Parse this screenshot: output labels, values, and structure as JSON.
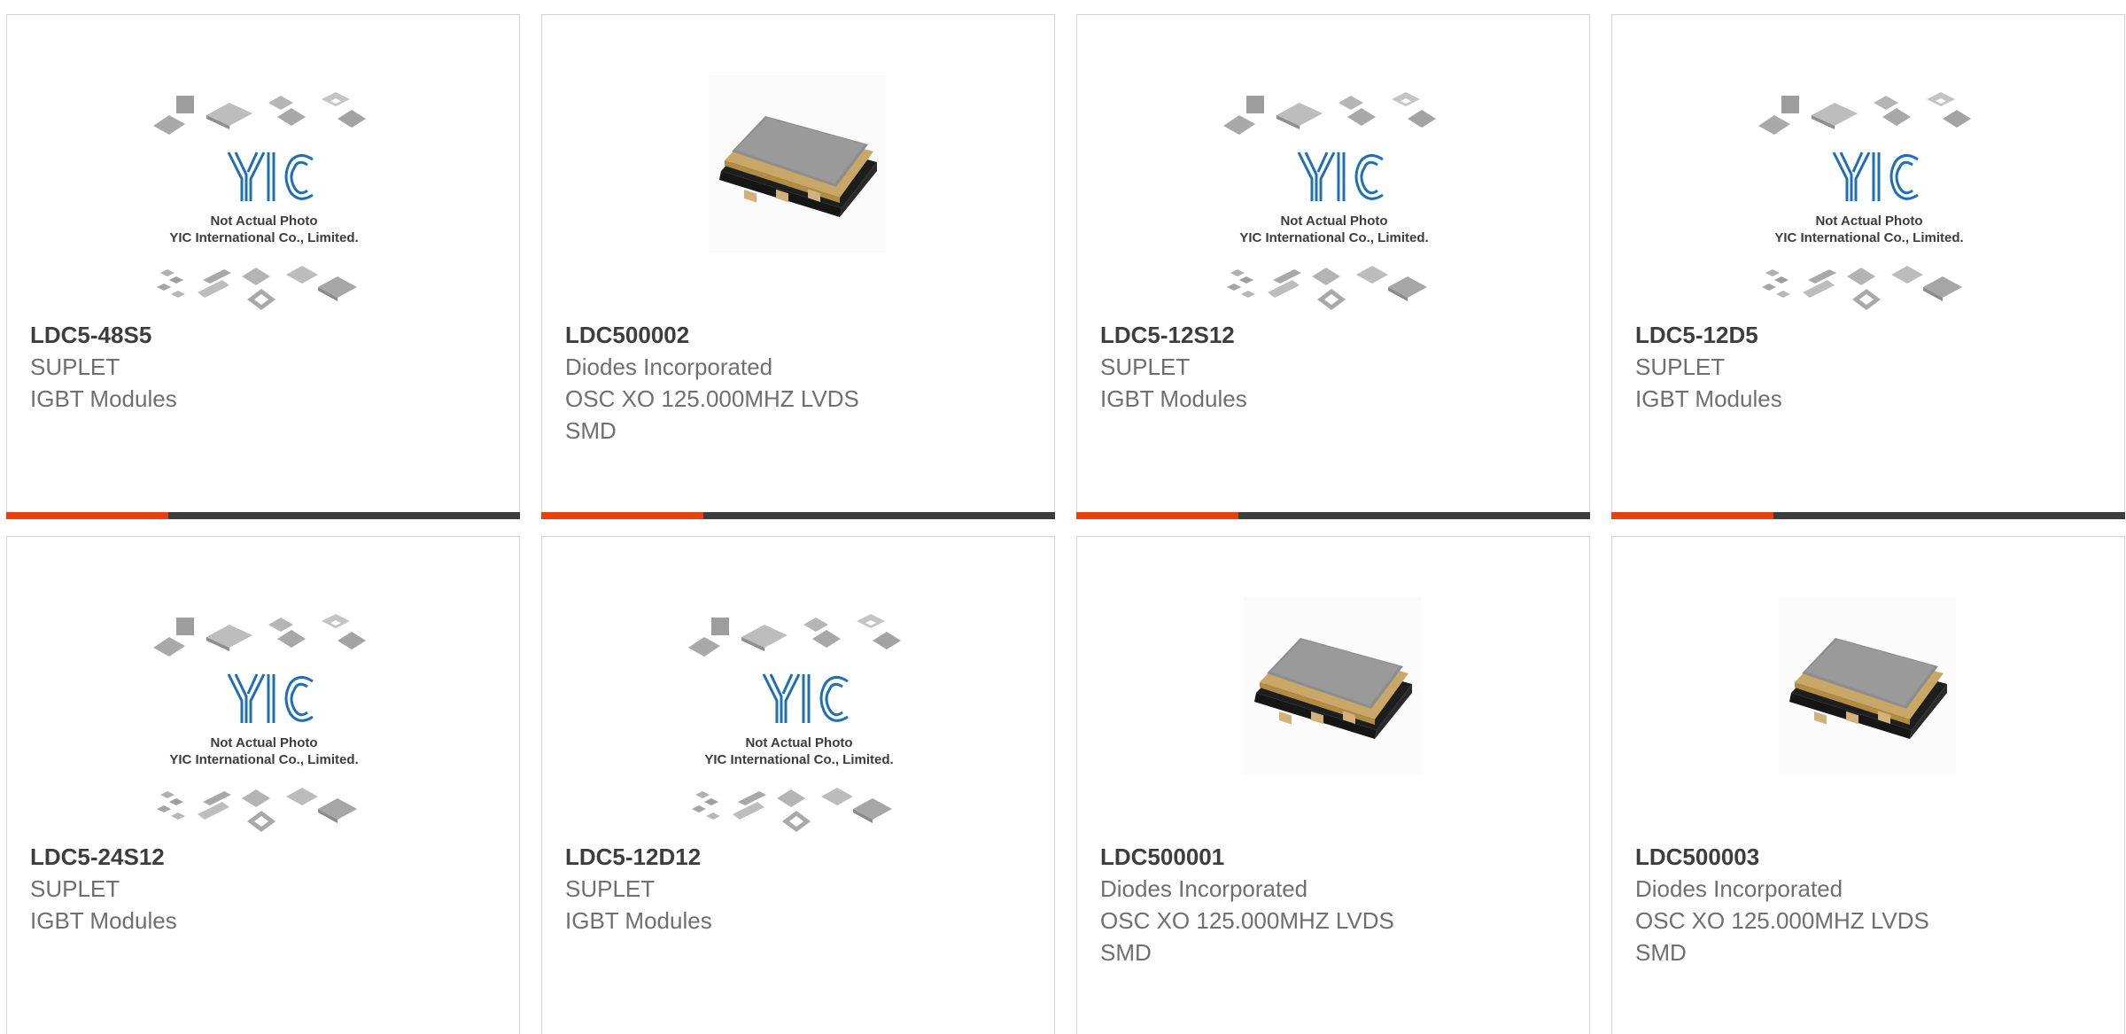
{
  "accent_color": "#e8410f",
  "bar_color": "#3d3d3d",
  "placeholder_image": {
    "icon": "yic-placeholder-icon",
    "logo_text": "YIC",
    "line1": "Not Actual Photo",
    "line2": "YIC International Co., Limited."
  },
  "products": [
    {
      "part_number": "LDC5-48S5",
      "manufacturer": "SUPLET",
      "description": "IGBT Modules",
      "image": "placeholder"
    },
    {
      "part_number": "LDC500002",
      "manufacturer": "Diodes Incorporated",
      "description": "OSC XO 125.000MHZ LVDS SMD",
      "image": "oscillator-chip"
    },
    {
      "part_number": "LDC5-12S12",
      "manufacturer": "SUPLET",
      "description": "IGBT Modules",
      "image": "placeholder"
    },
    {
      "part_number": "LDC5-12D5",
      "manufacturer": "SUPLET",
      "description": "IGBT Modules",
      "image": "placeholder"
    },
    {
      "part_number": "LDC5-24S12",
      "manufacturer": "SUPLET",
      "description": "IGBT Modules",
      "image": "placeholder"
    },
    {
      "part_number": "LDC5-12D12",
      "manufacturer": "SUPLET",
      "description": "IGBT Modules",
      "image": "placeholder"
    },
    {
      "part_number": "LDC500001",
      "manufacturer": "Diodes Incorporated",
      "description": "OSC XO 125.000MHZ LVDS SMD",
      "image": "oscillator-chip"
    },
    {
      "part_number": "LDC500003",
      "manufacturer": "Diodes Incorporated",
      "description": "OSC XO 125.000MHZ LVDS SMD",
      "image": "oscillator-chip"
    }
  ]
}
